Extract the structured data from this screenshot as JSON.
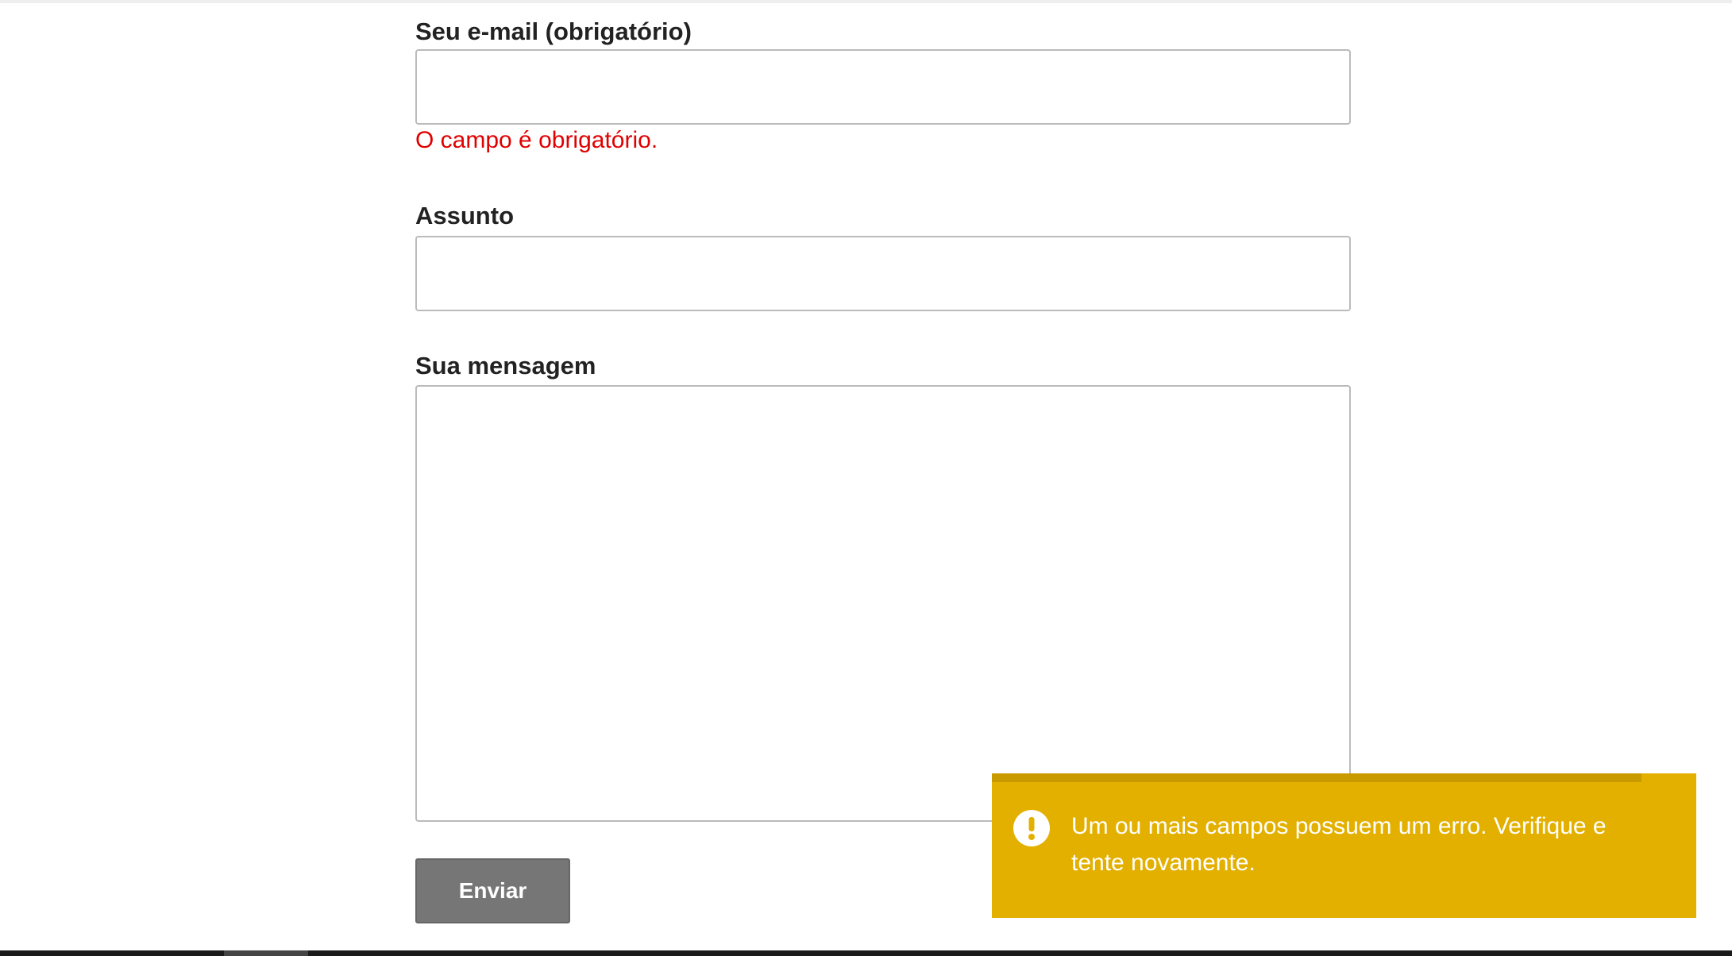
{
  "form": {
    "email": {
      "label": "Seu e-mail (obrigatório)",
      "value": "",
      "error": "O campo é obrigatório."
    },
    "subject": {
      "label": "Assunto",
      "value": ""
    },
    "message": {
      "label": "Sua mensagem",
      "value": ""
    },
    "submit_label": "Enviar"
  },
  "toast": {
    "icon": "exclamation-circle-icon",
    "message": "Um ou mais campos possuem um erro. Verifique e tente novamente.",
    "color": "#e3b000"
  },
  "colors": {
    "error_text": "#e00000",
    "button": "#767676"
  }
}
